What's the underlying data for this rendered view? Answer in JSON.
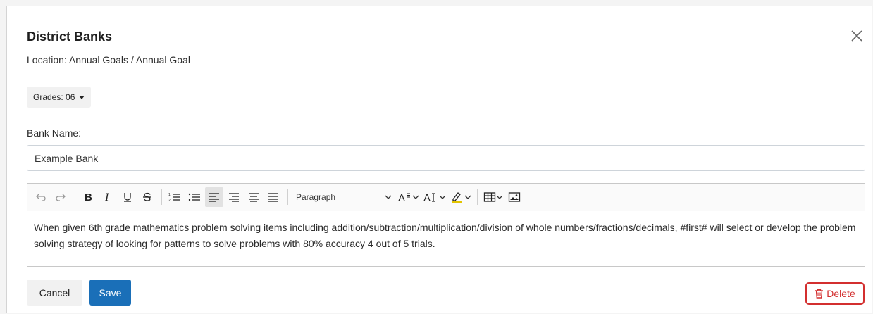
{
  "dialog": {
    "title": "District Banks",
    "location": "Location: Annual Goals / Annual Goal"
  },
  "grades": {
    "label": "Grades: 06"
  },
  "bank": {
    "label": "Bank Name:",
    "value": "Example Bank"
  },
  "editor": {
    "block_format": "Paragraph",
    "content": "When given 6th grade mathematics problem solving items including addition/subtraction/multiplication/division of whole numbers/fractions/decimals, #first# will select or develop the problem solving strategy of looking for patterns to solve problems with 80% accuracy 4 out of 5 trials.",
    "toolbar_icons": [
      "undo-icon",
      "redo-icon",
      "bold-icon",
      "italic-icon",
      "underline-icon",
      "strikethrough-icon",
      "numbered-list-icon",
      "bulleted-list-icon",
      "align-left-icon",
      "align-center-icon",
      "align-right-icon",
      "justify-icon",
      "font-size-icon",
      "text-case-icon",
      "highlight-icon",
      "table-icon",
      "image-icon"
    ]
  },
  "actions": {
    "cancel": "Cancel",
    "save": "Save",
    "delete": "Delete"
  },
  "colors": {
    "primary": "#1a6fb8",
    "danger": "#d32f2f"
  }
}
